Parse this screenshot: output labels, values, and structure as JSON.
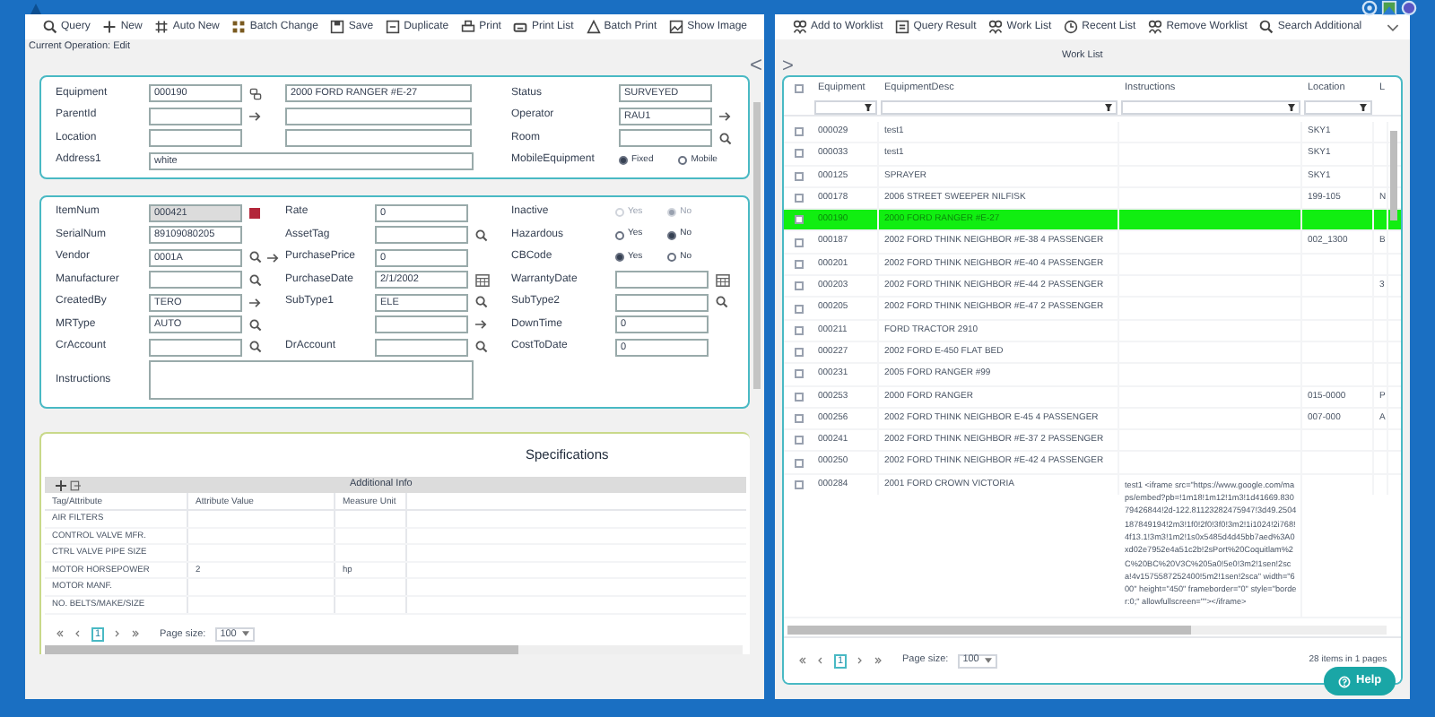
{
  "toolbar": [
    {
      "label": "Query"
    },
    {
      "label": "New"
    },
    {
      "label": "Auto New"
    },
    {
      "label": "Batch Change"
    },
    {
      "label": "Save"
    },
    {
      "label": "Duplicate"
    },
    {
      "label": "Print"
    },
    {
      "label": "Print List"
    },
    {
      "label": "Batch Print"
    },
    {
      "label": "Show Image"
    }
  ],
  "current_operation": "Current Operation: Edit",
  "collapse_arrow": "<",
  "general_group": {
    "rows": [
      [
        {
          "kind": "label",
          "text": "Equipment"
        },
        {
          "kind": "input",
          "value": "000190"
        },
        {
          "kind": "icons",
          "icons": [
            {
              "kind": "link"
            }
          ]
        },
        {
          "kind": "input",
          "value": "2000 FORD RANGER #E-27"
        },
        {
          "kind": "label",
          "text": "Status"
        },
        {
          "kind": "input",
          "value": "SURVEYED"
        },
        {
          "kind": "blank"
        }
      ],
      [
        {
          "kind": "label",
          "text": "ParentId"
        },
        {
          "kind": "input"
        },
        {
          "kind": "icons",
          "icons": [
            {
              "kind": "arrow"
            }
          ]
        },
        {
          "kind": "input"
        },
        {
          "kind": "label",
          "text": "Operator"
        },
        {
          "kind": "input",
          "value": "RAU1"
        },
        {
          "kind": "icons",
          "icons": [
            {
              "kind": "arrow"
            }
          ]
        }
      ],
      [
        {
          "kind": "label",
          "text": "Location"
        },
        {
          "kind": "input"
        },
        {
          "kind": "blank"
        },
        {
          "kind": "input"
        },
        {
          "kind": "label",
          "text": "Room"
        },
        {
          "kind": "input"
        },
        {
          "kind": "icons",
          "icons": [
            {
              "kind": "search"
            }
          ]
        }
      ],
      [
        {
          "kind": "label",
          "text": "Address1"
        },
        {
          "kind": "wide-input",
          "value": "white"
        },
        {
          "kind": "blank"
        },
        {
          "kind": "blank"
        },
        {
          "kind": "label",
          "text": "MobileEquipment"
        },
        {
          "kind": "radios",
          "disabled": false,
          "options": [
            {
              "label": "Fixed",
              "selected": true
            },
            {
              "label": "Mobile",
              "selected": false
            }
          ]
        }
      ]
    ]
  },
  "details_group": {
    "rows": [
      [
        {
          "kind": "label",
          "text": "ItemNum"
        },
        {
          "kind": "input",
          "value": "000421",
          "disabled": true
        },
        {
          "kind": "icons",
          "icons": [
            {
              "kind": "square"
            }
          ]
        },
        {
          "kind": "label",
          "text": "Rate"
        },
        {
          "kind": "input",
          "value": "0"
        },
        {
          "kind": "blank"
        },
        {
          "kind": "label",
          "text": "Inactive"
        },
        {
          "kind": "radios",
          "disabled": true,
          "options": [
            {
              "label": "Yes",
              "selected": false
            },
            {
              "label": "No",
              "selected": true
            }
          ]
        }
      ],
      [
        {
          "kind": "label",
          "text": "SerialNum"
        },
        {
          "kind": "input",
          "value": "89109080205"
        },
        {
          "kind": "blank"
        },
        {
          "kind": "label",
          "text": "AssetTag"
        },
        {
          "kind": "input"
        },
        {
          "kind": "icons",
          "icons": [
            {
              "kind": "search"
            }
          ]
        },
        {
          "kind": "label",
          "text": "Hazardous"
        },
        {
          "kind": "radios",
          "disabled": false,
          "options": [
            {
              "label": "Yes",
              "selected": false
            },
            {
              "label": "No",
              "selected": true
            }
          ]
        }
      ],
      [
        {
          "kind": "label",
          "text": "Vendor"
        },
        {
          "kind": "input",
          "value": "0001A"
        },
        {
          "kind": "icons",
          "icons": [
            {
              "kind": "search"
            },
            {
              "kind": "arrow"
            }
          ]
        },
        {
          "kind": "label",
          "text": "PurchasePrice"
        },
        {
          "kind": "input",
          "value": "0"
        },
        {
          "kind": "blank"
        },
        {
          "kind": "label",
          "text": "CBCode"
        },
        {
          "kind": "radios",
          "disabled": false,
          "options": [
            {
              "label": "Yes",
              "selected": true
            },
            {
              "label": "No",
              "selected": false
            }
          ]
        }
      ],
      [
        {
          "kind": "label",
          "text": "Manufacturer"
        },
        {
          "kind": "input"
        },
        {
          "kind": "icons",
          "icons": [
            {
              "kind": "search"
            }
          ]
        },
        {
          "kind": "label",
          "text": "PurchaseDate"
        },
        {
          "kind": "input",
          "value": "2/1/2002"
        },
        {
          "kind": "icons",
          "icons": [
            {
              "kind": "calendar"
            }
          ]
        },
        {
          "kind": "label",
          "text": "WarrantyDate"
        },
        {
          "kind": "input"
        },
        {
          "kind": "icons",
          "icons": [
            {
              "kind": "calendar"
            }
          ]
        }
      ],
      [
        {
          "kind": "label",
          "text": "CreatedBy"
        },
        {
          "kind": "input",
          "value": "TERO"
        },
        {
          "kind": "icons",
          "icons": [
            {
              "kind": "arrow"
            }
          ]
        },
        {
          "kind": "label",
          "text": "SubType1"
        },
        {
          "kind": "input",
          "value": "ELE"
        },
        {
          "kind": "icons",
          "icons": [
            {
              "kind": "search"
            }
          ]
        },
        {
          "kind": "label",
          "text": "SubType2"
        },
        {
          "kind": "input"
        },
        {
          "kind": "icons",
          "icons": [
            {
              "kind": "search"
            }
          ]
        }
      ],
      [
        {
          "kind": "label",
          "text": "MRType"
        },
        {
          "kind": "input",
          "value": "AUTO"
        },
        {
          "kind": "icons",
          "icons": [
            {
              "kind": "search"
            }
          ]
        },
        {
          "kind": "blank"
        },
        {
          "kind": "input"
        },
        {
          "kind": "icons",
          "icons": [
            {
              "kind": "arrow"
            }
          ]
        },
        {
          "kind": "label",
          "text": "DownTime"
        },
        {
          "kind": "input",
          "value": "0"
        },
        {
          "kind": "blank"
        }
      ],
      [
        {
          "kind": "label",
          "text": "CrAccount"
        },
        {
          "kind": "input"
        },
        {
          "kind": "icons",
          "icons": [
            {
              "kind": "search"
            }
          ]
        },
        {
          "kind": "label",
          "text": "DrAccount"
        },
        {
          "kind": "input"
        },
        {
          "kind": "icons",
          "icons": [
            {
              "kind": "search"
            }
          ]
        },
        {
          "kind": "label",
          "text": "CostToDate"
        },
        {
          "kind": "input",
          "value": "0"
        },
        {
          "kind": "blank"
        }
      ],
      [
        {
          "kind": "label",
          "text": "Instructions"
        },
        {
          "kind": "textarea"
        }
      ]
    ]
  },
  "specifications": {
    "title": "Specifications",
    "grid_title": "Additional Info",
    "columns": [
      "Tag/Attribute",
      "Attribute Value",
      "Measure Unit"
    ],
    "rows": [
      [
        "AIR FILTERS"
      ],
      [
        "CONTROL VALVE MFR."
      ],
      [
        "CTRL VALVE PIPE SIZE"
      ],
      [
        "MOTOR HORSEPOWER",
        "2",
        "hp"
      ],
      [
        "MOTOR MANF."
      ],
      [
        "NO. BELTS/MAKE/SIZE"
      ]
    ],
    "pager": {
      "pages": [
        {
          "label": "1",
          "selected": true
        }
      ],
      "page_size_label": "Page size:",
      "page_size": "100"
    }
  },
  "worklist_toolbar": [
    {
      "label": "Add to Worklist"
    },
    {
      "label": "Query Result"
    },
    {
      "label": "Work List"
    },
    {
      "label": "Recent List"
    },
    {
      "label": "Remove Worklist"
    },
    {
      "label": "Search Additional"
    }
  ],
  "expand_arrow": ">",
  "worklist": {
    "title": "Work List",
    "header_checked": false,
    "columns": [
      "Equipment",
      "EquipmentDesc",
      "Instructions",
      "Location",
      "L"
    ],
    "rows": [
      {
        "selected": false,
        "checked": false,
        "cells": [
          "000029",
          "test1",
          "",
          "SKY1",
          ""
        ]
      },
      {
        "selected": false,
        "checked": false,
        "cells": [
          "000033",
          "test1",
          "",
          "SKY1",
          ""
        ]
      },
      {
        "selected": false,
        "checked": false,
        "cells": [
          "000125",
          "SPRAYER",
          "",
          "SKY1",
          ""
        ]
      },
      {
        "selected": false,
        "checked": false,
        "cells": [
          "000178",
          "2006 STREET SWEEPER NILFISK",
          "",
          "199-105",
          "N"
        ]
      },
      {
        "selected": true,
        "checked": false,
        "cells": [
          "000190",
          "2000 FORD RANGER #E-27",
          "",
          "",
          ""
        ]
      },
      {
        "selected": false,
        "checked": false,
        "cells": [
          "000187",
          "2002 FORD THINK NEIGHBOR #E-38 4 PASSENGER",
          "",
          "002_1300",
          "B"
        ]
      },
      {
        "selected": false,
        "checked": false,
        "cells": [
          "000201",
          "2002 FORD THINK NEIGHBOR #E-40 4 PASSENGER",
          "",
          "",
          ""
        ]
      },
      {
        "selected": false,
        "checked": false,
        "cells": [
          "000203",
          "2002 FORD THINK NEIGHBOR #E-44 2 PASSENGER",
          "",
          "",
          "3"
        ]
      },
      {
        "selected": false,
        "checked": false,
        "cells": [
          "000205",
          "2002 FORD THINK NEIGHBOR #E-47 2 PASSENGER",
          "",
          "",
          ""
        ]
      },
      {
        "selected": false,
        "checked": false,
        "cells": [
          "000211",
          "FORD TRACTOR 2910",
          "",
          "",
          ""
        ]
      },
      {
        "selected": false,
        "checked": false,
        "cells": [
          "000227",
          "2002 FORD E-450 FLAT BED",
          "",
          "",
          ""
        ]
      },
      {
        "selected": false,
        "checked": false,
        "cells": [
          "000231",
          "2005 FORD RANGER #99",
          "",
          "",
          ""
        ]
      },
      {
        "selected": false,
        "checked": false,
        "cells": [
          "000253",
          "2000 FORD RANGER",
          "",
          "015-0000",
          "P"
        ]
      },
      {
        "selected": false,
        "checked": false,
        "cells": [
          "000256",
          "2002 FORD THINK NEIGHBOR E-45 4 PASSENGER",
          "",
          "007-000",
          "A"
        ]
      },
      {
        "selected": false,
        "checked": false,
        "cells": [
          "000241",
          "2002 FORD THINK NEIGHBOR #E-37 2 PASSENGER",
          "",
          "",
          ""
        ]
      },
      {
        "selected": false,
        "checked": false,
        "cells": [
          "000250",
          "2002 FORD THINK NEIGHBOR #E-42 4 PASSENGER",
          "",
          "",
          ""
        ]
      },
      {
        "selected": false,
        "checked": false,
        "cells": [
          "000284",
          "2001 FORD CROWN VICTORIA",
          "test1 <iframe src=\"https://www.google.com/maps/embed?pb=!1m18!1m12!1m3!1d41669.83079426844!2d-122.81123282475947!3d49.2504187849194!2m3!1f0!2f0!3f0!3m2!1i1024!2i768!4f13.1!3m3!1m2!1s0x5485d4d45bb7aed%3A0xd02e7952e4a51c2b!2sPort%20Coquitlam%2C%20BC%20V3C%205a0!5e0!3m2!1sen!2sca!4v1575587252400!5m2!1sen!2sca\" width=\"600\" height=\"450\" frameborder=\"0\" style=\"border:0;\" allowfullscreen=\"\"></iframe>",
          "",
          ""
        ]
      }
    ],
    "pager": {
      "pages": [
        {
          "label": "1",
          "selected": true
        }
      ],
      "page_size_label": "Page size:",
      "page_size": "100"
    },
    "summary": "28 items in 1 pages"
  },
  "help_button": "Help"
}
